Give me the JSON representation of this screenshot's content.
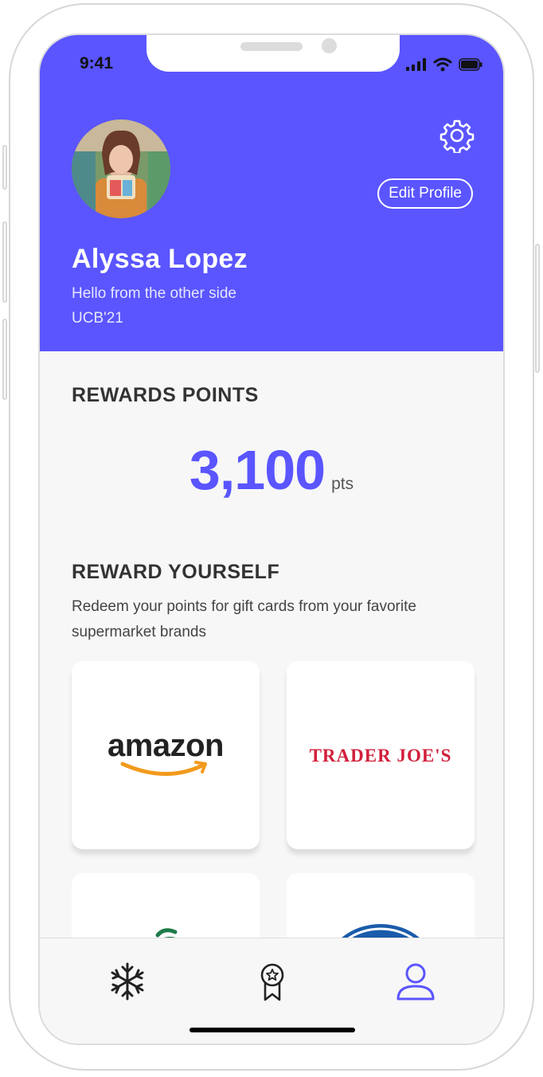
{
  "status_bar": {
    "time": "9:41"
  },
  "profile": {
    "name": "Alyssa Lopez",
    "tagline": "Hello from the other side",
    "school": "UCB'21",
    "edit_label": "Edit Profile",
    "avatar_icon": "profile-photo"
  },
  "rewards": {
    "title": "REWARDS POINTS",
    "points": "3,100",
    "unit": "pts"
  },
  "reward_yourself": {
    "title": "REWARD YOURSELF",
    "description": "Redeem your points for gift cards from your favorite supermarket brands",
    "cards": [
      {
        "brand": "amazon"
      },
      {
        "brand": "TRADER JOE'S"
      }
    ]
  },
  "tabs": [
    {
      "icon": "snowflake-icon",
      "active": false
    },
    {
      "icon": "award-ribbon-icon",
      "active": false
    },
    {
      "icon": "user-icon",
      "active": true
    }
  ],
  "colors": {
    "accent": "#5a55ff",
    "trader_joes_red": "#d21f3c",
    "amazon_orange": "#f29a1c"
  }
}
